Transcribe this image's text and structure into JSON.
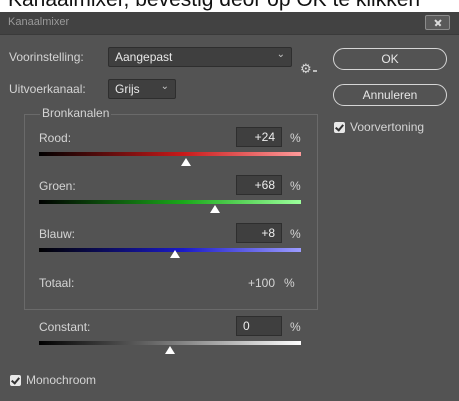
{
  "caption": "Kanaalmixer, bevestig deor op OK te klikken",
  "dialog": {
    "title": "Kanaalmixer"
  },
  "preset": {
    "label": "Voorinstelling:",
    "value": "Aangepast",
    "chevron": "⌄",
    "gear_icon": "⚙"
  },
  "output": {
    "label": "Uitvoerkanaal:",
    "value": "Grijs",
    "chevron": "⌄"
  },
  "buttons": {
    "ok": "OK",
    "cancel": "Annuleren"
  },
  "preview": {
    "label": "Voorvertoning",
    "checked": true
  },
  "source_channels": {
    "legend": "Bronkanalen",
    "channels": [
      {
        "label": "Rood:",
        "value": "+24",
        "unit": "%",
        "percent": 24,
        "color": "#d01c1c"
      },
      {
        "label": "Groen:",
        "value": "+68",
        "unit": "%",
        "percent": 68,
        "color": "#1ca81c"
      },
      {
        "label": "Blauw:",
        "value": "+8",
        "unit": "%",
        "percent": 8,
        "color": "#1c1cd0"
      }
    ],
    "total": {
      "label": "Totaal:",
      "value": "+100",
      "unit": "%"
    }
  },
  "constant": {
    "label": "Constant:",
    "value": "0",
    "unit": "%",
    "percent": 0
  },
  "monochrome": {
    "label": "Monochroom",
    "checked": true
  }
}
